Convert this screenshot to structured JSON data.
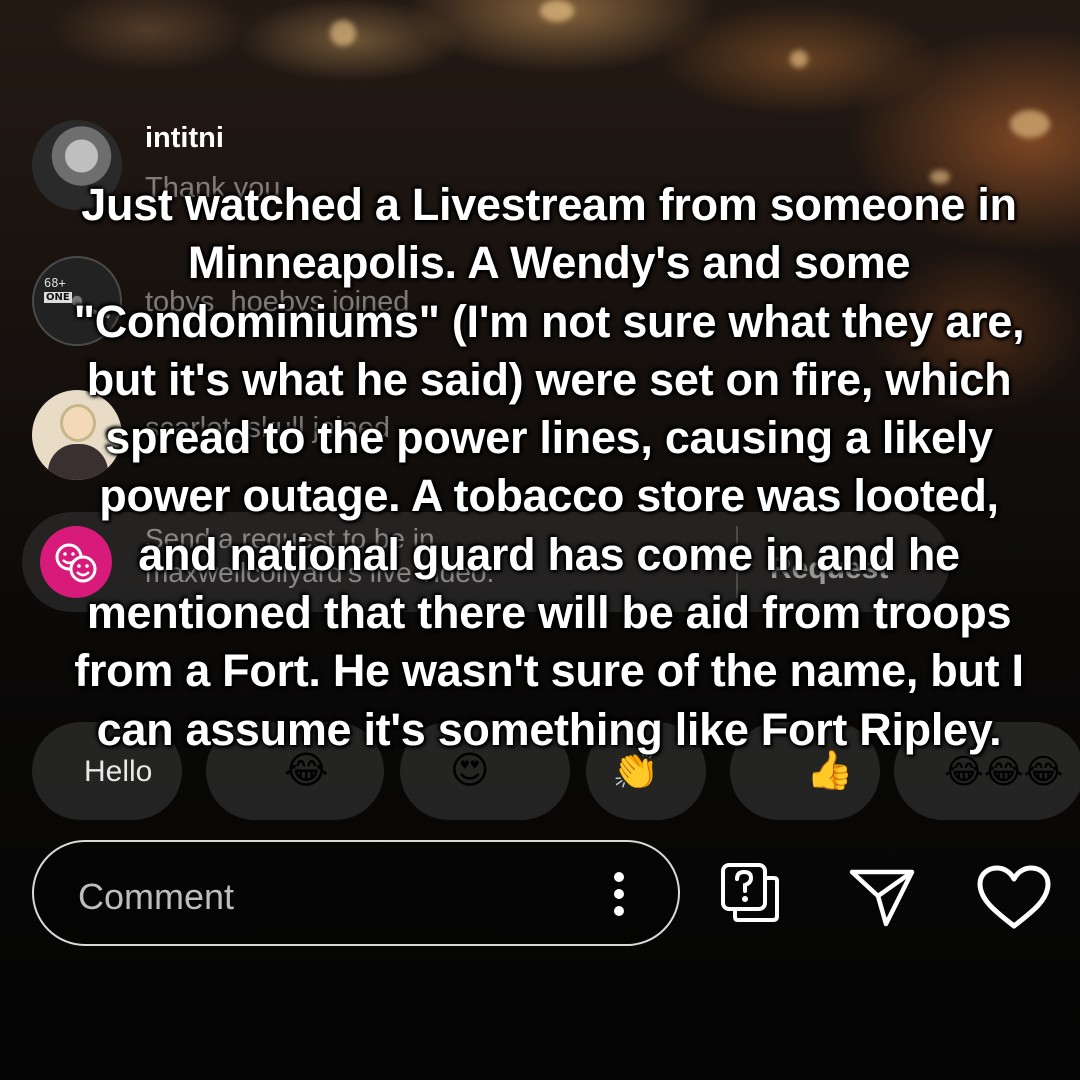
{
  "comments": [
    {
      "username": "intitni",
      "text": "Thank you"
    },
    {
      "username": "",
      "text": "tobys_hoebys joined"
    },
    {
      "username": "",
      "text": "scarlet_skull joined"
    }
  ],
  "request": {
    "text": "Send a request to be in maxwellcollyard's live video.",
    "button_label": "Request"
  },
  "quick_replies": {
    "text_chip": "Hello",
    "emojis": [
      "😂",
      "😍",
      "👏",
      "👍",
      "😂😂😂"
    ]
  },
  "comment_input": {
    "placeholder": "Comment"
  },
  "icons": [
    "more-vertical-icon",
    "question-bubble-icon",
    "send-icon",
    "heart-icon"
  ],
  "caption": "Just watched a Livestream from someone in Minneapolis. A Wendy's and some \"Condominiums\" (I'm not sure what they are, but it's what he said) were set on fire, which spread to the power lines, causing a likely power outage. A tobacco store was looted, and national guard has come in and he mentioned that there will be aid from troops from a Fort. He wasn't sure of the name, but I can assume it's something like Fort Ripley.",
  "colors": {
    "accent": "#d81b7a",
    "text": "#ffffff"
  }
}
